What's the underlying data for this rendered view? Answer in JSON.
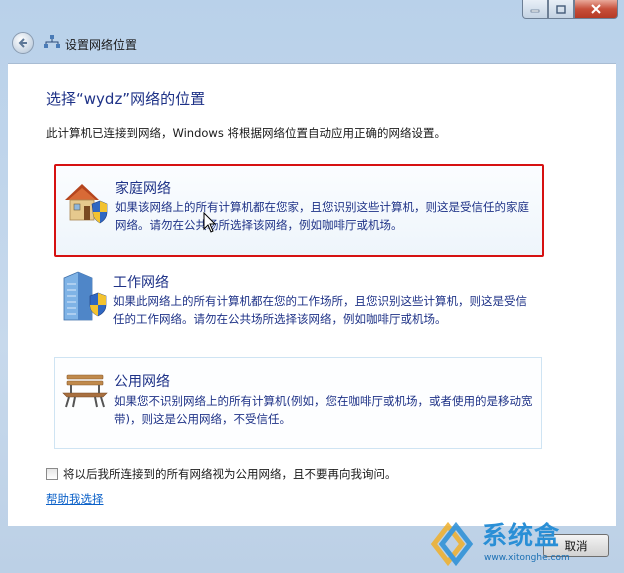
{
  "window": {
    "title": "设置网络位置",
    "controls": {
      "minimize_icon": "minimize-icon",
      "maximize_icon": "maximize-icon",
      "close_icon": "close-icon"
    }
  },
  "content": {
    "heading": "选择“wydz”网络的位置",
    "intro": "此计算机已连接到网络，Windows 将根据网络位置自动应用正确的网络设置。",
    "options": [
      {
        "title": "家庭网络",
        "description": "如果该网络上的所有计算机都在您家，且您识别这些计算机，则这是受信任的家庭网络。请勿在公共场所选择该网络，例如咖啡厅或机场。",
        "icon": "home-network-icon",
        "highlighted": true
      },
      {
        "title": "工作网络",
        "description": "如果此网络上的所有计算机都在您的工作场所，且您识别这些计算机，则这是受信任的工作网络。请勿在公共场所选择该网络，例如咖啡厅或机场。",
        "icon": "work-network-icon"
      },
      {
        "title": "公用网络",
        "description": "如果您不识别网络上的所有计算机(例如，您在咖啡厅或机场，或者使用的是移动宽带)，则这是公用网络，不受信任。",
        "icon": "public-network-icon"
      }
    ],
    "checkbox": {
      "label": "将以后我所连接到的所有网络视为公用网络，且不要再向我询问。",
      "checked": false
    },
    "help_link": "帮助我选择"
  },
  "footer": {
    "cancel_label": "取消"
  },
  "watermark": {
    "text": "系统盒",
    "url": "www.xitonghe.com"
  },
  "colors": {
    "heading": "#1e3287",
    "link": "#0a60c8",
    "highlight_border": "#d61111",
    "close_button": "#c74f3a"
  }
}
